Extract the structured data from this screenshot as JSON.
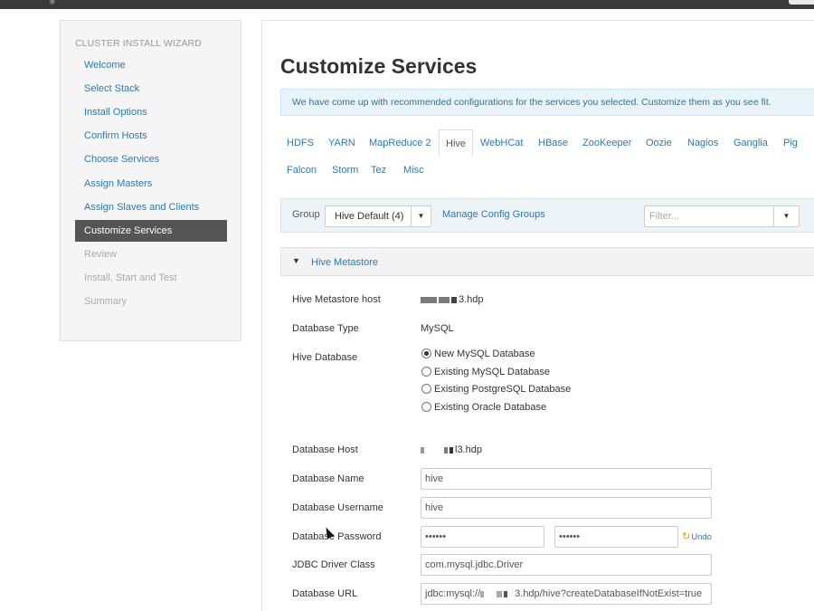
{
  "wizard": {
    "title": "CLUSTER INSTALL WIZARD",
    "steps": [
      {
        "label": "Welcome",
        "state": "done"
      },
      {
        "label": "Select Stack",
        "state": "done"
      },
      {
        "label": "Install Options",
        "state": "done"
      },
      {
        "label": "Confirm Hosts",
        "state": "done"
      },
      {
        "label": "Choose Services",
        "state": "done"
      },
      {
        "label": "Assign Masters",
        "state": "done"
      },
      {
        "label": "Assign Slaves and Clients",
        "state": "done"
      },
      {
        "label": "Customize Services",
        "state": "active"
      },
      {
        "label": "Review",
        "state": "disabled"
      },
      {
        "label": "Install, Start and Test",
        "state": "disabled"
      },
      {
        "label": "Summary",
        "state": "disabled"
      }
    ]
  },
  "main": {
    "title": "Customize Services",
    "alert": "We have come up with recommended configurations for the services you selected. Customize them as you see fit.",
    "tabs": [
      "HDFS",
      "YARN",
      "MapReduce 2",
      "Hive",
      "WebHCat",
      "HBase",
      "ZooKeeper",
      "Oozie",
      "Nagios",
      "Ganglia",
      "Pig",
      "Falcon",
      "Storm",
      "Tez",
      "Misc"
    ],
    "active_tab": "Hive",
    "group": {
      "label": "Group",
      "selected": "Hive Default (4)",
      "manage_link": "Manage Config Groups",
      "filter_placeholder": "Filter..."
    },
    "section": {
      "title": "Hive Metastore",
      "metastore_host_label": "Hive Metastore host",
      "metastore_host_value": "3.hdp",
      "db_type_label": "Database Type",
      "db_type_value": "MySQL",
      "hive_db_label": "Hive Database",
      "hive_db_options": [
        "New MySQL Database",
        "Existing MySQL Database",
        "Existing PostgreSQL Database",
        "Existing Oracle Database"
      ],
      "hive_db_selected": 0,
      "db_host_label": "Database Host",
      "db_host_value": "l3.hdp",
      "db_name_label": "Database Name",
      "db_name_value": "hive",
      "db_user_label": "Database Username",
      "db_user_value": "hive",
      "db_pass_label": "Database Password",
      "db_pass_value": "••••••",
      "db_pass_confirm": "••••••",
      "undo_label": "Undo",
      "jdbc_label": "JDBC Driver Class",
      "jdbc_value": "com.mysql.jdbc.Driver",
      "db_url_label": "Database URL",
      "db_url_prefix": "jdbc:mysql://",
      "db_url_suffix": "3.hdp/hive?createDatabaseIfNotExist=true"
    }
  }
}
